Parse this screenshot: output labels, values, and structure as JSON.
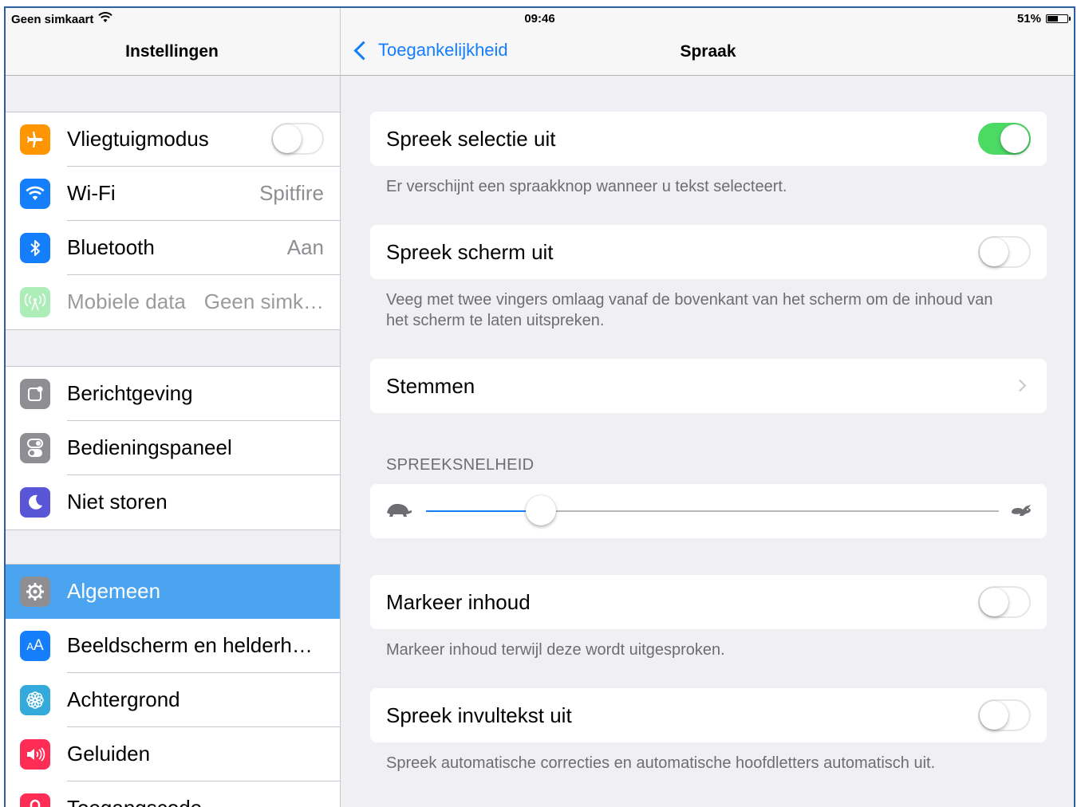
{
  "status_bar": {
    "carrier": "Geen simkaart",
    "time": "09:46",
    "battery": "51%",
    "battery_level": 0.51
  },
  "master": {
    "title": "Instellingen",
    "groups": [
      [
        {
          "label": "Vliegtuigmodus",
          "icon": "airplane-icon",
          "color": "#ff9500",
          "control": "toggle",
          "on": false
        },
        {
          "label": "Wi-Fi",
          "icon": "wifi-icon",
          "color": "#147efb",
          "value": "Spitfire"
        },
        {
          "label": "Bluetooth",
          "icon": "bluetooth-icon",
          "color": "#147efb",
          "value": "Aan"
        },
        {
          "label": "Mobiele data",
          "icon": "antenna-icon",
          "color": "#4cd964",
          "value": "Geen simk…",
          "disabled": true
        }
      ],
      [
        {
          "label": "Berichtgeving",
          "icon": "notifications-icon",
          "color": "#8e8e93"
        },
        {
          "label": "Bedieningspaneel",
          "icon": "control-center-icon",
          "color": "#8e8e93"
        },
        {
          "label": "Niet storen",
          "icon": "moon-icon",
          "color": "#5856d6"
        }
      ],
      [
        {
          "label": "Algemeen",
          "icon": "gear-icon",
          "color": "#8e8e93",
          "selected": true
        },
        {
          "label": "Beeldscherm en helderh…",
          "icon": "display-brightness-icon",
          "color": "#147efb"
        },
        {
          "label": "Achtergrond",
          "icon": "wallpaper-flower-icon",
          "color": "#34aadc"
        },
        {
          "label": "Geluiden",
          "icon": "speaker-icon",
          "color": "#ff2d55"
        },
        {
          "label": "Toegangscode",
          "icon": "lock-icon",
          "color": "#ff2d55"
        }
      ]
    ]
  },
  "detail": {
    "back_label": "Toegankelijkheid",
    "title": "Spraak",
    "items": {
      "speak_selection": {
        "label": "Spreek selectie uit",
        "on": true,
        "footer": "Er verschijnt een spraakknop wanneer u tekst selecteert."
      },
      "speak_screen": {
        "label": "Spreek scherm uit",
        "on": false,
        "footer": "Veeg met twee vingers omlaag vanaf de bovenkant van het scherm om de inhoud van het scherm te laten uitspreken."
      },
      "voices": {
        "label": "Stemmen"
      },
      "rate_header": "SPREEKSNELHEID",
      "rate": 0.2,
      "highlight": {
        "label": "Markeer inhoud",
        "on": false,
        "footer": "Markeer inhoud terwijl deze wordt uitgesproken."
      },
      "speak_autotext": {
        "label": "Spreek invultekst uit",
        "on": false,
        "footer": "Spreek automatische correcties en automatische hoofdletters automatisch uit."
      }
    }
  }
}
